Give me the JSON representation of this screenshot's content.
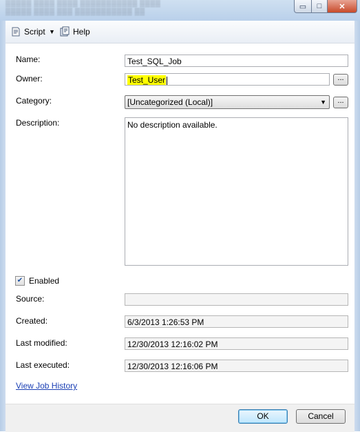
{
  "toolbar": {
    "script_label": "Script",
    "help_label": "Help"
  },
  "window_controls": {
    "minimize": "▭",
    "maximize": "□",
    "close": "✕"
  },
  "fields": {
    "name": {
      "label": "Name:",
      "value": "Test_SQL_Job"
    },
    "owner": {
      "label": "Owner:",
      "value": "Test_User",
      "button": "..."
    },
    "category": {
      "label": "Category:",
      "value": "[Uncategorized (Local)]",
      "button": "..."
    },
    "description": {
      "label": "Description:",
      "value": "No description available."
    },
    "enabled": {
      "label": "Enabled",
      "checked": true
    },
    "source": {
      "label": "Source:",
      "value": ""
    },
    "created": {
      "label": "Created:",
      "value": "6/3/2013 1:26:53 PM"
    },
    "last_modified": {
      "label": "Last modified:",
      "value": "12/30/2013 12:16:02 PM"
    },
    "last_executed": {
      "label": "Last executed:",
      "value": "12/30/2013 12:16:06 PM"
    }
  },
  "links": {
    "view_history": "View Job History"
  },
  "buttons": {
    "ok": "OK",
    "cancel": "Cancel"
  },
  "colors": {
    "highlight": "#ffff00",
    "link": "#1a3fb4",
    "ok_button": "#bee6fd"
  }
}
